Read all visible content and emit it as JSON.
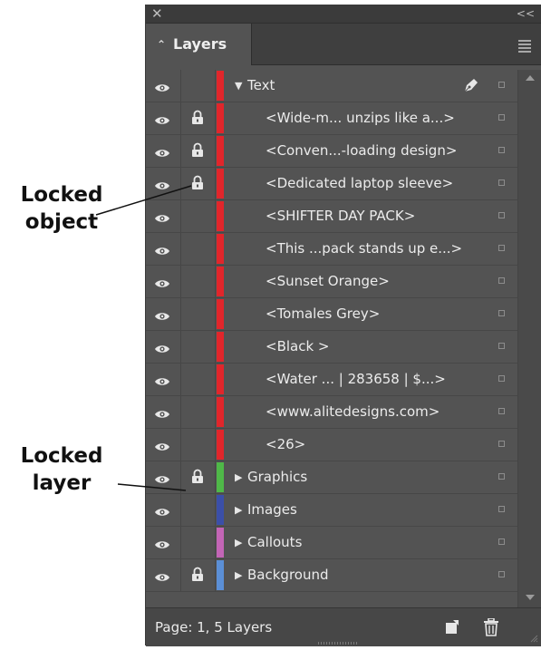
{
  "callouts": {
    "locked_object": {
      "line1": "Locked",
      "line2": "object"
    },
    "locked_layer": {
      "line1": "Locked",
      "line2": "layer"
    }
  },
  "panel": {
    "tab_title": "Layers",
    "footer_text": "Page: 1, 5 Layers"
  },
  "rows": [
    {
      "name": "Text",
      "kind": "layer",
      "expanded": true,
      "locked": false,
      "color": "#e1262b",
      "pen": true
    },
    {
      "name": "<Wide-m... unzips like a...>",
      "kind": "object",
      "locked": true,
      "color": "#e1262b"
    },
    {
      "name": "<Conven...-loading design>",
      "kind": "object",
      "locked": true,
      "color": "#e1262b"
    },
    {
      "name": "<Dedicated laptop sleeve>",
      "kind": "object",
      "locked": true,
      "color": "#e1262b"
    },
    {
      "name": "<SHIFTER DAY PACK>",
      "kind": "object",
      "locked": false,
      "color": "#e1262b"
    },
    {
      "name": "<This ...pack stands up e...>",
      "kind": "object",
      "locked": false,
      "color": "#e1262b"
    },
    {
      "name": "<Sunset Orange>",
      "kind": "object",
      "locked": false,
      "color": "#e1262b"
    },
    {
      "name": "<Tomales Grey>",
      "kind": "object",
      "locked": false,
      "color": "#e1262b"
    },
    {
      "name": "<Black >",
      "kind": "object",
      "locked": false,
      "color": "#e1262b"
    },
    {
      "name": "<Water ... | 283658 | $...>",
      "kind": "object",
      "locked": false,
      "color": "#e1262b"
    },
    {
      "name": "<www.alitedesigns.com>",
      "kind": "object",
      "locked": false,
      "color": "#e1262b"
    },
    {
      "name": "<26>",
      "kind": "object",
      "locked": false,
      "color": "#e1262b"
    },
    {
      "name": "Graphics",
      "kind": "layer",
      "expanded": false,
      "locked": true,
      "color": "#4fb848"
    },
    {
      "name": "Images",
      "kind": "layer",
      "expanded": false,
      "locked": false,
      "color": "#3b4fa8"
    },
    {
      "name": "Callouts",
      "kind": "layer",
      "expanded": false,
      "locked": false,
      "color": "#c365b6"
    },
    {
      "name": "Background",
      "kind": "layer",
      "expanded": false,
      "locked": true,
      "color": "#5b8fd6"
    }
  ]
}
